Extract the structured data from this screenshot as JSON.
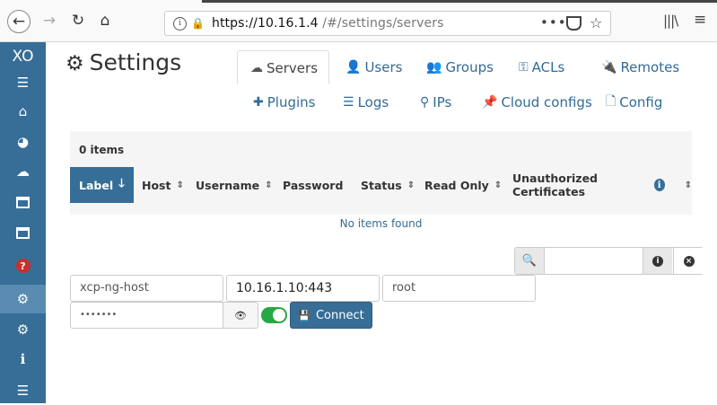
{
  "browser": {
    "url_host": "https://10.16.1.4",
    "url_path": "/#/settings/servers",
    "dots": "•••"
  },
  "sidebar": {
    "logo": "XO",
    "items": [
      {
        "name": "menu",
        "icon": "menu-icon"
      },
      {
        "name": "home",
        "icon": "home-icon"
      },
      {
        "name": "dashboard",
        "icon": "dashboard-icon"
      },
      {
        "name": "cloud",
        "icon": "cloud-icon"
      },
      {
        "name": "backup",
        "icon": "archive-icon"
      },
      {
        "name": "backup-ng",
        "icon": "archive-icon"
      },
      {
        "name": "help",
        "icon": "question-icon",
        "label": "?"
      },
      {
        "name": "settings",
        "icon": "gear-icon",
        "active": true
      },
      {
        "name": "jobs",
        "icon": "gears-icon"
      },
      {
        "name": "about",
        "icon": "info-icon",
        "label": "i"
      },
      {
        "name": "tasks",
        "icon": "database-icon"
      }
    ]
  },
  "header": {
    "title": "Settings",
    "tabs_row1": [
      {
        "label": "Servers",
        "icon": "cloud-icon",
        "active": true
      },
      {
        "label": "Users",
        "icon": "user-icon"
      },
      {
        "label": "Groups",
        "icon": "users-icon"
      },
      {
        "label": "ACLs",
        "icon": "key-icon"
      },
      {
        "label": "Remotes",
        "icon": "plug-icon"
      }
    ],
    "tabs_row2": [
      {
        "label": "Plugins",
        "icon": "puzzle-icon"
      },
      {
        "label": "Logs",
        "icon": "list-icon"
      },
      {
        "label": "IPs",
        "icon": "map-marker-icon"
      },
      {
        "label": "Cloud configs",
        "icon": "thumbtack-icon"
      },
      {
        "label": "Config",
        "icon": "file-icon"
      }
    ]
  },
  "table": {
    "count_label": "0 items",
    "columns": [
      "Label",
      "Host",
      "Username",
      "Password",
      "Status",
      "Read Only",
      "Unauthorized Certificates"
    ],
    "sorted_column": "Label",
    "empty_text": "No items found"
  },
  "filter": {
    "value": ""
  },
  "form": {
    "label_value": "xcp-ng-host",
    "host_value": "10.16.1.10:443",
    "username_value": "root",
    "password_value": "•••••••",
    "allow_unauthorized": true,
    "connect_label": "Connect"
  },
  "colors": {
    "primary": "#366e98",
    "success": "#28a745",
    "danger": "#c9302c"
  }
}
